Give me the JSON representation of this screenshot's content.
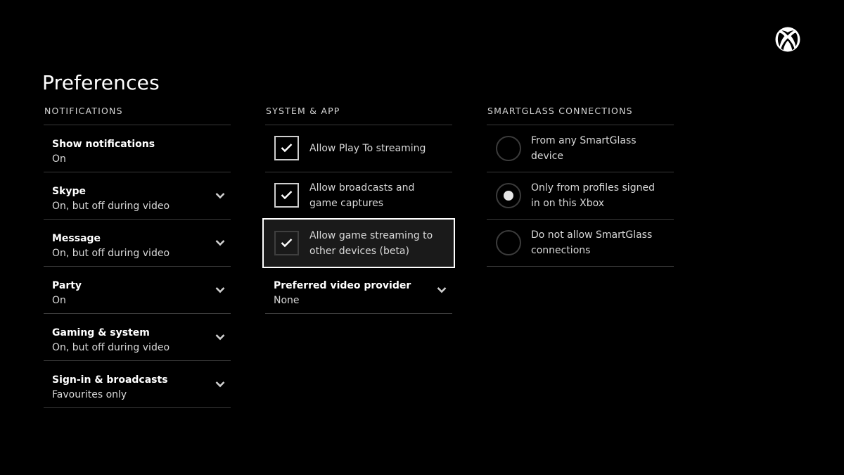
{
  "page": {
    "title": "Preferences"
  },
  "colors": {
    "background": "#000000",
    "text": "#ffffff",
    "secondary_text": "#d8d8d8",
    "divider": "#3a3a3a",
    "focus_border": "#ffffff"
  },
  "notifications": {
    "header": "NOTIFICATIONS",
    "items": [
      {
        "title": "Show notifications",
        "value": "On"
      },
      {
        "title": "Skype",
        "value": "On, but off during video"
      },
      {
        "title": "Message",
        "value": "On, but off during video"
      },
      {
        "title": "Party",
        "value": "On"
      },
      {
        "title": "Gaming & system",
        "value": "On, but off during video"
      },
      {
        "title": "Sign-in & broadcasts",
        "value": "Favourites only"
      }
    ]
  },
  "system_app": {
    "header": "SYSTEM & APP",
    "checkboxes": [
      {
        "label": "Allow Play To streaming",
        "checked": true
      },
      {
        "label": "Allow broadcasts and game captures",
        "checked": true
      },
      {
        "label": "Allow game streaming to other devices (beta)",
        "checked": true,
        "focused": true
      }
    ],
    "video_provider": {
      "title": "Preferred video provider",
      "value": "None"
    }
  },
  "smartglass": {
    "header": "SMARTGLASS CONNECTIONS",
    "options": [
      {
        "label": "From any SmartGlass device",
        "selected": false
      },
      {
        "label": "Only from profiles signed in on this Xbox",
        "selected": true
      },
      {
        "label": "Do not allow SmartGlass connections",
        "selected": false
      }
    ]
  },
  "icons": {
    "logo": "xbox-logo-icon",
    "chevron": "chevron-down-icon",
    "check": "check-icon"
  }
}
